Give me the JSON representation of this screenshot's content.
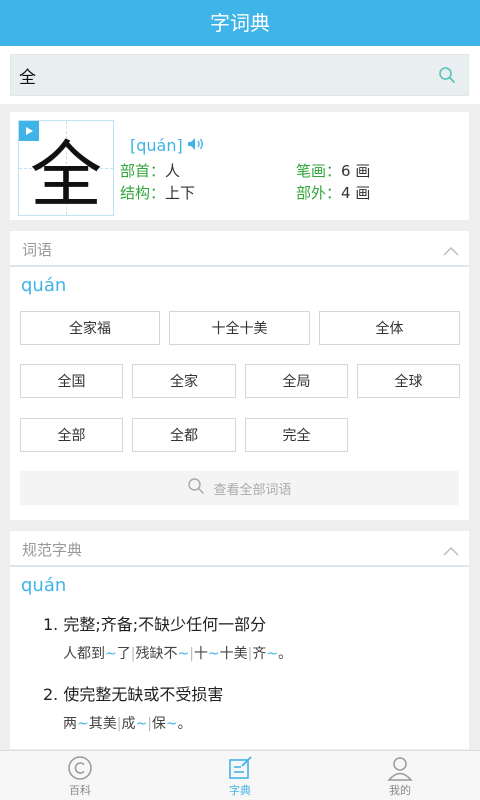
{
  "app": {
    "title": "字词典"
  },
  "search": {
    "query": "全"
  },
  "entry": {
    "character": "全",
    "pinyin": "[quán]",
    "radical_label": "部首：",
    "radical": "人",
    "strokes_label": "笔画：",
    "strokes": "6 画",
    "structure_label": "结构：",
    "structure": "上下",
    "outside_label": "部外：",
    "outside": "4 画"
  },
  "words": {
    "title": "词语",
    "pinyin": "quán",
    "items": [
      "全家福",
      "十全十美",
      "全体",
      "全国",
      "全家",
      "全局",
      "全球",
      "全部",
      "全都",
      "完全"
    ],
    "more": "查看全部词语"
  },
  "dict": {
    "title": "规范字典",
    "pinyin": "quán",
    "definitions": [
      {
        "text": "1. 完整;齐备;不缺少任何一部分",
        "examples": [
          [
            "人都到",
            "~",
            "了"
          ],
          [
            "残缺不",
            "~"
          ],
          [
            "十",
            "~",
            "十美"
          ],
          [
            "齐",
            "~",
            "。"
          ]
        ]
      },
      {
        "text": "2. 使完整无缺或不受损害",
        "examples": [
          [
            "两",
            "~",
            "其美"
          ],
          [
            "成",
            "~"
          ],
          [
            "保",
            "~",
            "。"
          ]
        ]
      }
    ]
  },
  "tabs": [
    {
      "label": "百科",
      "icon": "copyright-circle-icon"
    },
    {
      "label": "字典",
      "icon": "edit-note-icon"
    },
    {
      "label": "我的",
      "icon": "person-icon"
    }
  ],
  "colors": {
    "accent": "#3fb4e8",
    "label_green": "#2fa63a",
    "background": "#eeeeee"
  }
}
